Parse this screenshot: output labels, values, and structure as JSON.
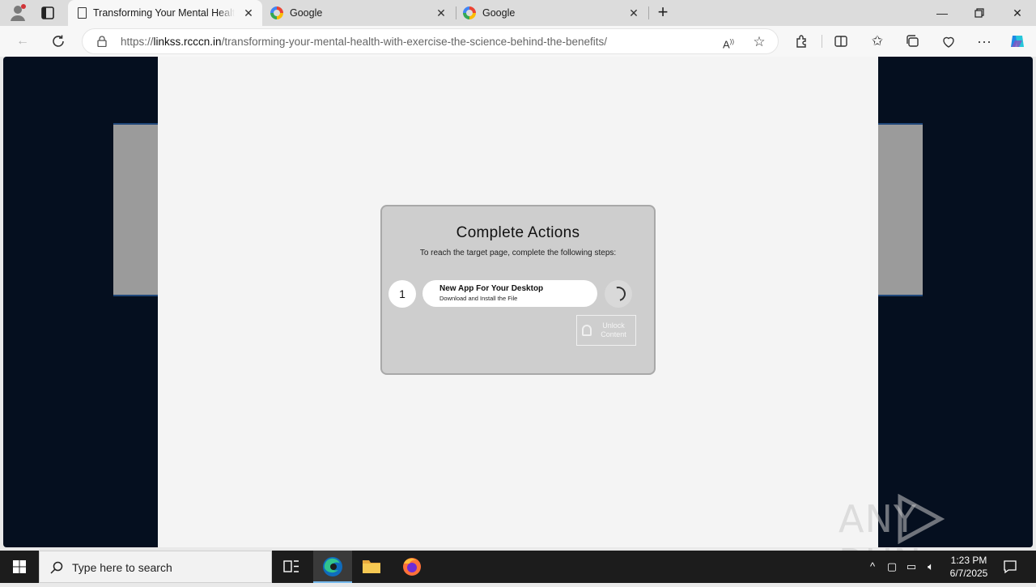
{
  "browser": {
    "tabs": [
      {
        "title": "Transforming Your Mental Health",
        "active": true
      },
      {
        "title": "Google",
        "active": false
      },
      {
        "title": "Google",
        "active": false
      }
    ],
    "url_scheme": "https://",
    "url_host": "linkss.rcccn.in",
    "url_path": "/transforming-your-mental-health-with-exercise-the-science-behind-the-benefits/"
  },
  "modal": {
    "title": "Complete Actions",
    "subtitle": "To reach the target page, complete the following steps:",
    "step": {
      "number": "1",
      "title": "New App For Your Desktop",
      "description": "Download and Install the File"
    },
    "unlock_label": "Unlock Content"
  },
  "watermark": "ANY RUN",
  "taskbar": {
    "search_placeholder": "Type here to search",
    "time": "1:23 PM",
    "date": "6/7/2025"
  },
  "colors": {
    "viewport_bg": "#050f1f",
    "content_bg": "#f4f4f4",
    "modal_bg": "#cecece",
    "side_panel_bg": "#9b9b9b",
    "side_panel_border": "#20477a",
    "taskbar_bg": "#1c1c1c",
    "edge_accent": "#0f6cbd"
  }
}
